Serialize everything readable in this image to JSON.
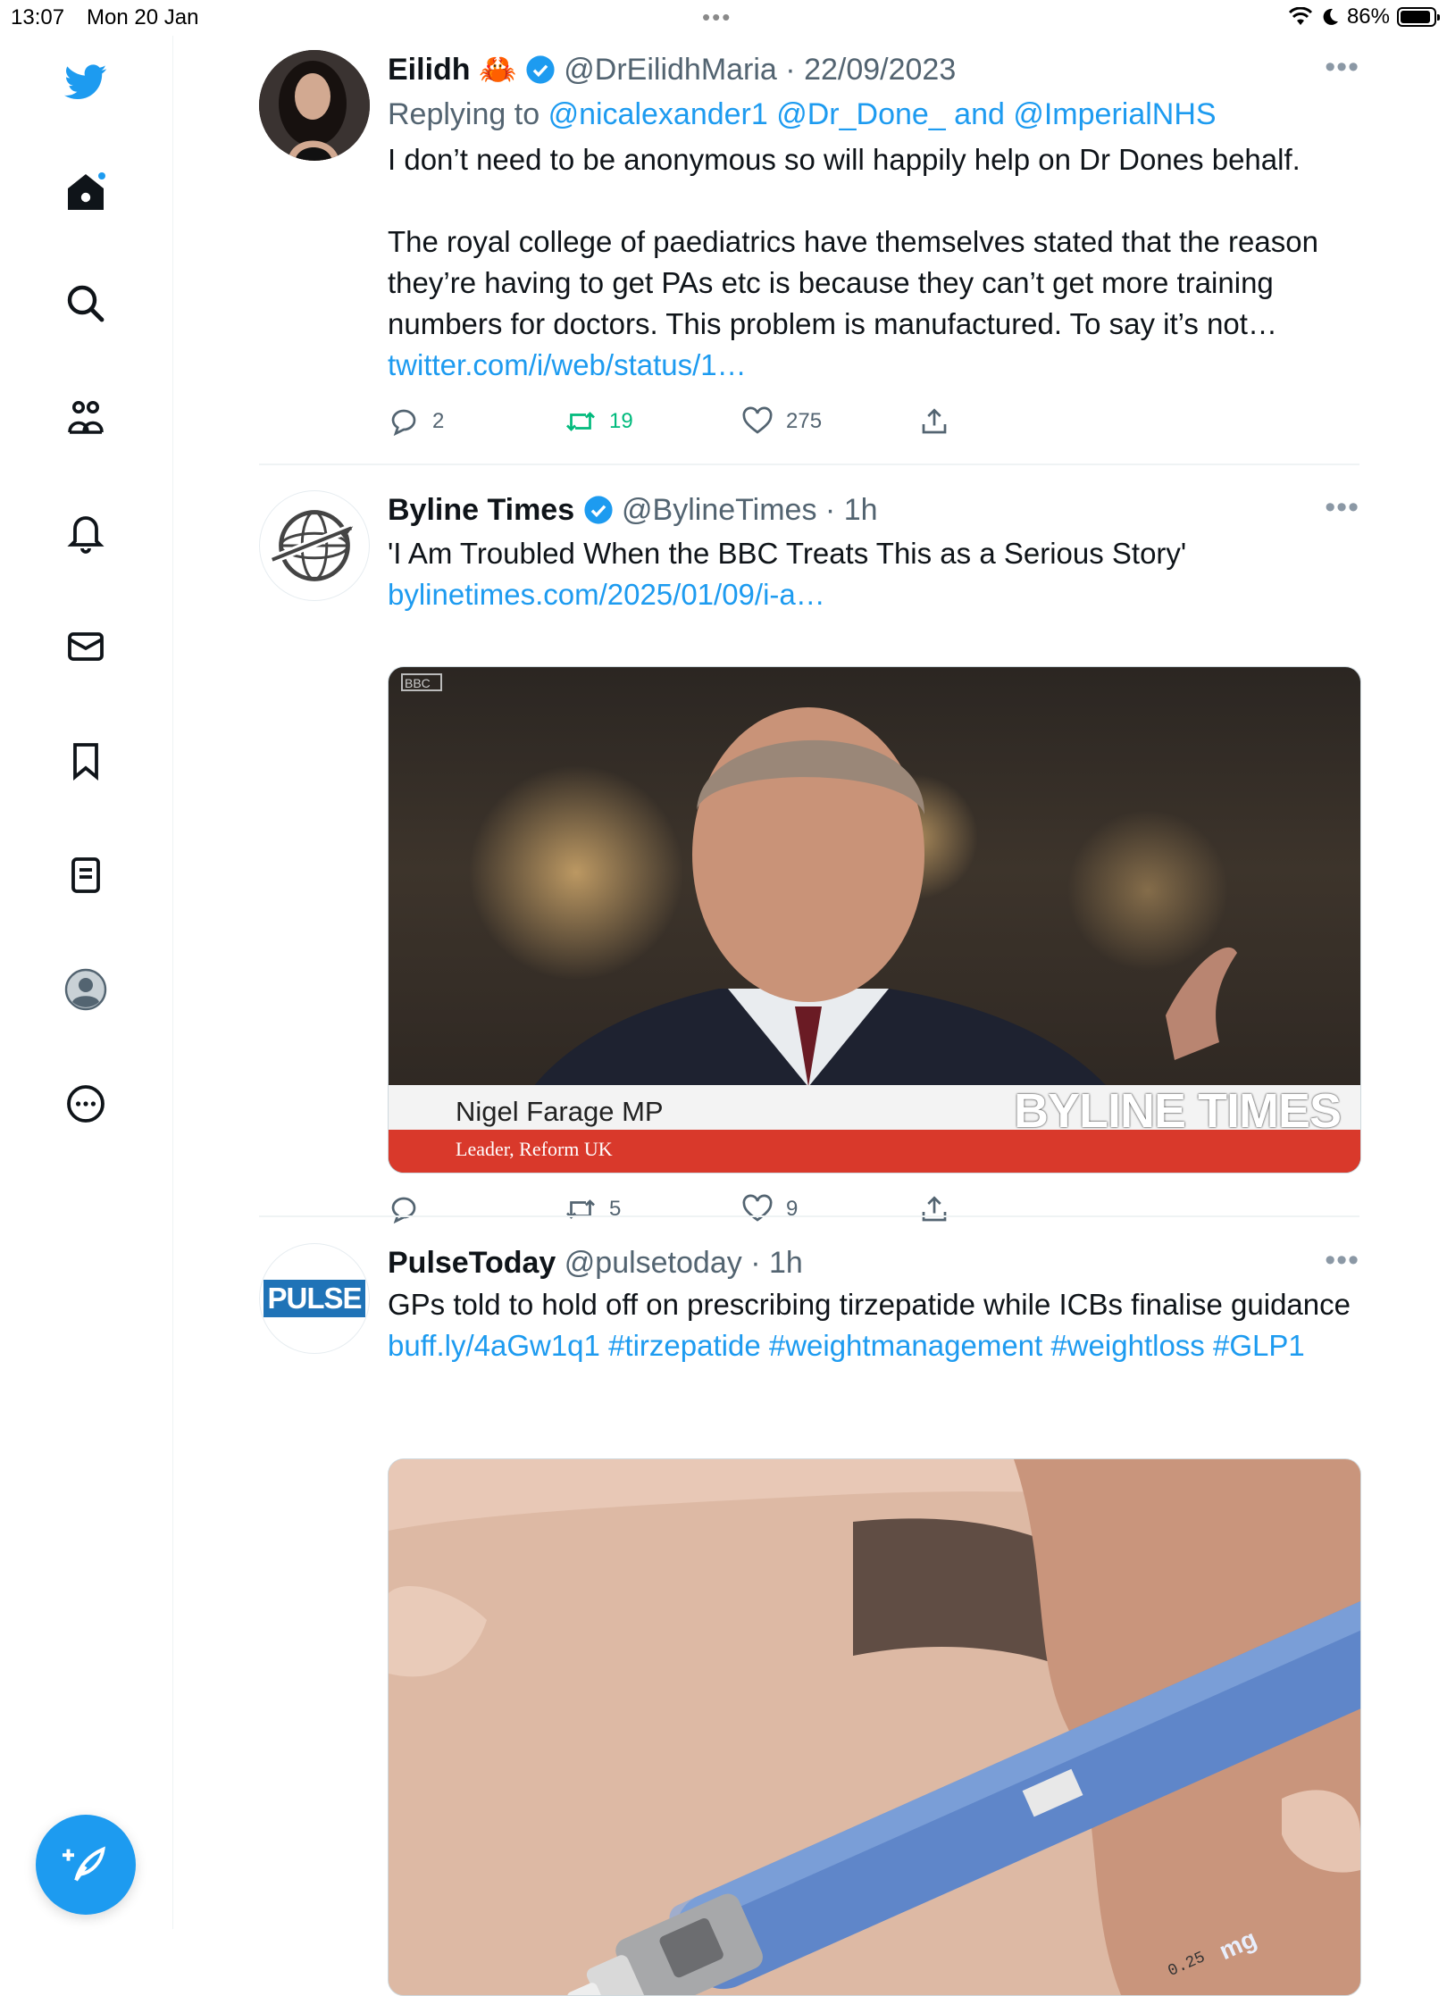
{
  "status_bar": {
    "time": "13:07",
    "date": "Mon 20 Jan",
    "battery": "86%"
  },
  "sidebar": {
    "items": [
      "twitter-logo",
      "home",
      "explore",
      "communities",
      "notifications",
      "messages",
      "bookmarks",
      "lists",
      "profile",
      "more"
    ],
    "accent": "#1d9bf0"
  },
  "tweets": [
    {
      "name": "Eilidh",
      "emoji": "🦀",
      "handle": "@DrEilidhMaria",
      "time": "· 22/09/2023",
      "replying_prefix": "Replying to",
      "replying_users": "@nicalexander1 @Dr_Done_ and @ImperialNHS",
      "text1": "I don’t need to be anonymous so will happily help on Dr Dones behalf.",
      "text2": "The royal college of paediatrics have themselves stated that the reason they’re having to get PAs etc is because they can’t get more training numbers for doctors. This problem is manufactured. To say it’s not…",
      "link": "twitter.com/i/web/status/1…",
      "replies": "2",
      "retweets": "19",
      "likes": "275"
    },
    {
      "name": "Byline Times",
      "handle": "@BylineTimes",
      "time": "· 1h",
      "text": "'I Am Troubled When the BBC Treats This as a Serious Story'",
      "link": "bylinetimes.com/2025/01/09/i-a…",
      "media_caption_name": "Nigel Farage MP",
      "media_caption_role": "Leader, Reform UK",
      "media_watermark": "BYLINE TIMES",
      "media_bug": "BBC",
      "retweets": "5",
      "likes": "9"
    },
    {
      "name": "PulseToday",
      "handle": "@pulsetoday",
      "time": "· 1h",
      "text": "GPs told to hold off on prescribing tirzepatide while ICBs finalise guidance",
      "link": "buff.ly/4aGw1q1",
      "hashtags_line1": "#tirzepatide #weightmanagement",
      "hashtags_line2": "#weightloss #GLP1",
      "avatar_text": "PULSE",
      "media_label": "0.25",
      "media_label2": "mg"
    }
  ]
}
